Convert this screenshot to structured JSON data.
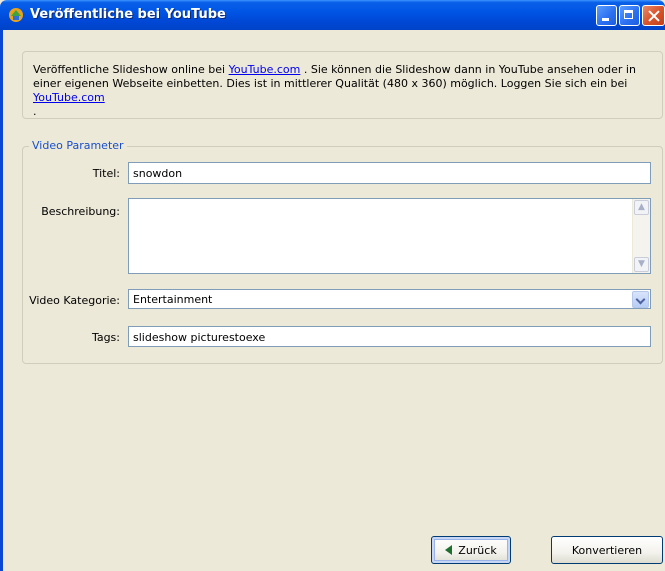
{
  "window": {
    "title": "Veröffentliche bei YouTube"
  },
  "info": {
    "text_1": "Veröffentliche Slideshow online bei ",
    "link_1": "YouTube.com",
    "text_2": " . Sie können die Slideshow dann in YouTube ansehen oder in einer eigenen Webseite einbetten. Dies ist in mittlerer Qualität (480 x 360) möglich. Loggen Sie sich ein bei ",
    "link_2": "YouTube.com",
    "text_3": " ."
  },
  "video_parameter": {
    "legend": "Video Parameter",
    "title_label": "Titel:",
    "title_value": "snowdon",
    "description_label": "Beschreibung:",
    "description_value": "",
    "category_label": "Video Kategorie:",
    "category_value": "Entertainment",
    "tags_label": "Tags:",
    "tags_value": "slideshow picturestoexe"
  },
  "buttons": {
    "back_label": "Zurück",
    "convert_label": "Konvertieren"
  },
  "colors": {
    "title_bar": "#0055e5",
    "link": "#0000ee",
    "legend": "#1a4fc9",
    "window_bg": "#ece9d8"
  }
}
